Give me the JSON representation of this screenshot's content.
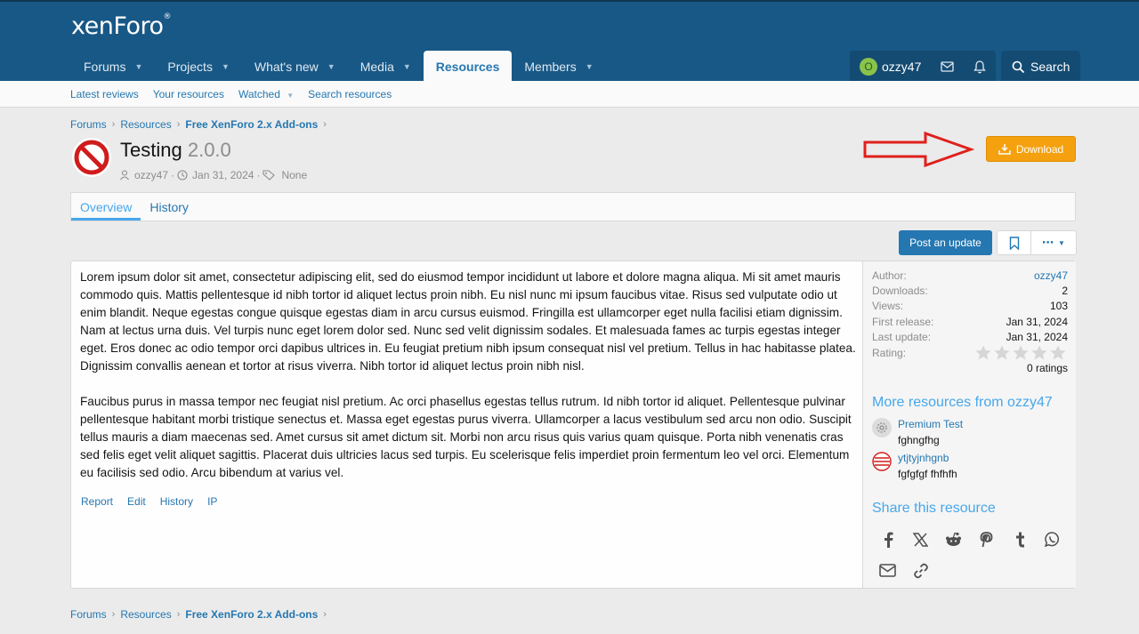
{
  "header": {
    "logo": "xenForo",
    "logo_mark": "®",
    "nav": [
      {
        "label": "Forums",
        "caret": true
      },
      {
        "label": "Projects",
        "caret": true
      },
      {
        "label": "What's new",
        "caret": true
      },
      {
        "label": "Media",
        "caret": true
      },
      {
        "label": "Resources",
        "caret": false,
        "active": true
      },
      {
        "label": "Members",
        "caret": true
      }
    ],
    "user": {
      "avatar_letter": "O",
      "name": "ozzy47"
    },
    "search_label": "Search"
  },
  "subnav": [
    "Latest reviews",
    "Your resources",
    "Watched",
    "Search resources"
  ],
  "breadcrumbs": [
    "Forums",
    "Resources",
    "Free XenForo 2.x Add-ons"
  ],
  "resource": {
    "title": "Testing",
    "version": "2.0.0",
    "author": "ozzy47",
    "date": "Jan 31, 2024",
    "tags": "None",
    "download_label": "Download"
  },
  "tabs": [
    "Overview",
    "History"
  ],
  "buttons": {
    "post_update": "Post an update",
    "more": "⋯"
  },
  "content": {
    "paragraphs": [
      "Lorem ipsum dolor sit amet, consectetur adipiscing elit, sed do eiusmod tempor incididunt ut labore et dolore magna aliqua. Mi sit amet mauris commodo quis. Mattis pellentesque id nibh tortor id aliquet lectus proin nibh. Eu nisl nunc mi ipsum faucibus vitae. Risus sed vulputate odio ut enim blandit. Neque egestas congue quisque egestas diam in arcu cursus euismod. Fringilla est ullamcorper eget nulla facilisi etiam dignissim. Nam at lectus urna duis. Vel turpis nunc eget lorem dolor sed. Nunc sed velit dignissim sodales. Et malesuada fames ac turpis egestas integer eget. Eros donec ac odio tempor orci dapibus ultrices in. Eu feugiat pretium nibh ipsum consequat nisl vel pretium. Tellus in hac habitasse platea. Dignissim convallis aenean et tortor at risus viverra. Nibh tortor id aliquet lectus proin nibh nisl.",
      "Faucibus purus in massa tempor nec feugiat nisl pretium. Ac orci phasellus egestas tellus rutrum. Id nibh tortor id aliquet. Pellentesque pulvinar pellentesque habitant morbi tristique senectus et. Massa eget egestas purus viverra. Ullamcorper a lacus vestibulum sed arcu non odio. Suscipit tellus mauris a diam maecenas sed. Amet cursus sit amet dictum sit. Morbi non arcu risus quis varius quam quisque. Porta nibh venenatis cras sed felis eget velit aliquet sagittis. Placerat duis ultricies lacus sed turpis. Eu scelerisque felis imperdiet proin fermentum leo vel orci. Elementum eu facilisis sed odio. Arcu bibendum at varius vel."
    ],
    "actions": [
      "Report",
      "Edit",
      "History",
      "IP"
    ]
  },
  "sidebar": {
    "info": [
      {
        "k": "Author:",
        "v": "ozzy47"
      },
      {
        "k": "Downloads:",
        "v": "2"
      },
      {
        "k": "Views:",
        "v": "103"
      },
      {
        "k": "First release:",
        "v": "Jan 31, 2024"
      },
      {
        "k": "Last update:",
        "v": "Jan 31, 2024"
      },
      {
        "k": "Rating:",
        "v": ""
      }
    ],
    "rating": 0,
    "ratings_count": "0 ratings",
    "more_heading": "More resources from ozzy47",
    "more": [
      {
        "title": "Premium Test",
        "desc": "fghngfhg"
      },
      {
        "title": "ytjtyjnhgnb",
        "desc": "fgfgfgf fhfhfh"
      }
    ],
    "share_heading": "Share this resource",
    "share_icons": [
      "facebook-icon",
      "x-icon",
      "reddit-icon",
      "pinterest-icon",
      "tumblr-icon",
      "whatsapp-icon",
      "email-icon",
      "link-icon"
    ]
  },
  "colors": {
    "header": "#185886",
    "accent": "#2577b1",
    "download": "#f5a00f",
    "annotation_arrow": "#e0201c"
  }
}
